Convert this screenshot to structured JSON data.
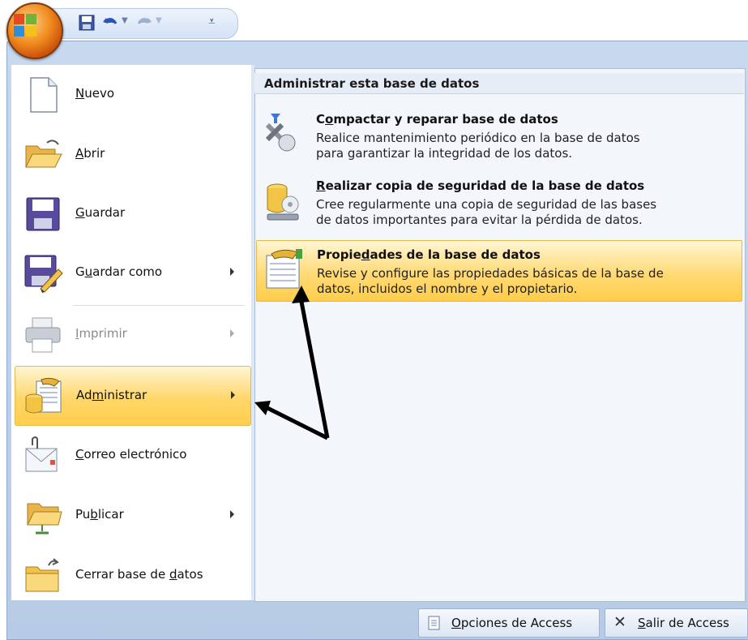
{
  "left_menu": {
    "items": [
      {
        "label_pre": "",
        "label_u": "N",
        "label_post": "uevo"
      },
      {
        "label_pre": "",
        "label_u": "A",
        "label_post": "brir"
      },
      {
        "label_pre": "",
        "label_u": "G",
        "label_post": "uardar"
      },
      {
        "label_pre": "G",
        "label_u": "u",
        "label_post": "ardar como"
      },
      {
        "label_pre": "",
        "label_u": "I",
        "label_post": "mprimir"
      },
      {
        "label_pre": "Ad",
        "label_u": "m",
        "label_post": "inistrar"
      },
      {
        "label_pre": "",
        "label_u": "C",
        "label_post": "orreo electrónico"
      },
      {
        "label_pre": "Pu",
        "label_u": "b",
        "label_post": "licar"
      },
      {
        "label_pre": "Cerrar base de ",
        "label_u": "d",
        "label_post": "atos"
      }
    ]
  },
  "right_pane": {
    "title": "Administrar esta base de datos",
    "items": [
      {
        "title_pre": "C",
        "title_u": "o",
        "title_post": "mpactar y reparar base de datos",
        "desc1": "Realice mantenimiento periódico en la base de datos",
        "desc2": "para garantizar la integridad de los datos."
      },
      {
        "title_pre": "",
        "title_u": "R",
        "title_post": "ealizar copia de seguridad de la base de datos",
        "desc1": "Cree regularmente una copia de seguridad de las bases",
        "desc2": "de datos importantes para evitar la pérdida de datos."
      },
      {
        "title_pre": "Propie",
        "title_u": "d",
        "title_post": "ades de la base de datos",
        "desc1": "Revise y configure las propiedades básicas de la base de",
        "desc2": "datos, incluidos el nombre y el propietario."
      }
    ]
  },
  "bottom_bar": {
    "options_u": "O",
    "options_post": "pciones de Access",
    "exit_u": "S",
    "exit_post": "alir de Access"
  },
  "colors": {
    "highlight": "#ffd66a",
    "frame": "#b7cbe6",
    "accent_orange": "#f08a1c"
  }
}
